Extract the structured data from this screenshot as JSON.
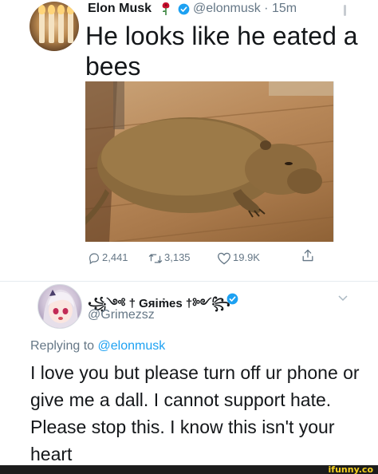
{
  "tweet1": {
    "author_name": "Elon Musk",
    "handle_time": "@elonmusk · 15m",
    "text": "He looks like he eated a bees",
    "actions": {
      "replies": "2,441",
      "retweets": "3,135",
      "likes": "19.9K"
    }
  },
  "tweet2": {
    "author_name": "꧁༺ † Gяiṁes †༻꧂",
    "handle": "@Grimezsz",
    "replying_prefix": "Replying to ",
    "replying_to": "@elonmusk",
    "text": "I love you but please turn off ur phone or give me a dall.  I cannot support hate.  Please stop this. I know this isn't your heart"
  },
  "footer": {
    "watermark": "ifunny.co"
  },
  "colors": {
    "verified": "#1da1f2",
    "secondary_text": "#657786",
    "primary_text": "#14171a",
    "rose": "#c8102e"
  }
}
